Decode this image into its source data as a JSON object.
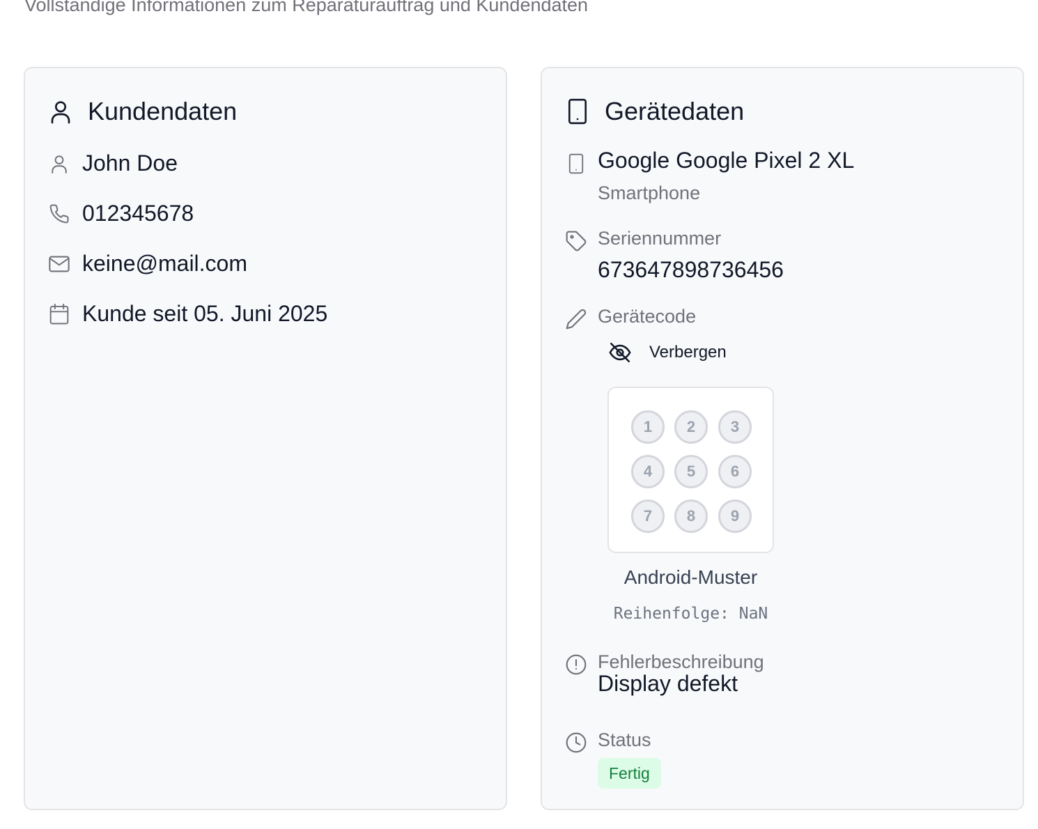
{
  "page": {
    "subtitle": "Vollständige Informationen zum Reparaturauftrag und Kundendaten"
  },
  "customer": {
    "title": "Kundendaten",
    "title_icon": "user-icon",
    "name": "John Doe",
    "phone": "012345678",
    "email": "keine@mail.com",
    "since": "Kunde seit 05. Juni 2025",
    "icons": [
      "user-icon",
      "phone-icon",
      "mail-icon",
      "calendar-icon"
    ]
  },
  "device": {
    "title": "Gerätedaten",
    "title_icon": "smartphone-icon",
    "model": "Google Google Pixel 2 XL",
    "type": "Smartphone",
    "serial_label": "Seriennummer",
    "serial_value": "673647898736456",
    "code_label": "Gerätecode",
    "toggle_label": "Verbergen",
    "pattern_digits": [
      "1",
      "2",
      "3",
      "4",
      "5",
      "6",
      "7",
      "8",
      "9"
    ],
    "pattern_caption": "Android-Muster",
    "pattern_sequence": "Reihenfolge: NaN",
    "fault_label": "Fehlerbeschreibung",
    "fault_value": "Display defekt",
    "status_label": "Status",
    "status_value": "Fertig"
  },
  "colors": {
    "card_bg": "#f8f9fb",
    "card_border": "#e4e4e7",
    "muted_text": "#71717a",
    "status_bg": "#dcfce7",
    "status_text": "#15803d"
  }
}
